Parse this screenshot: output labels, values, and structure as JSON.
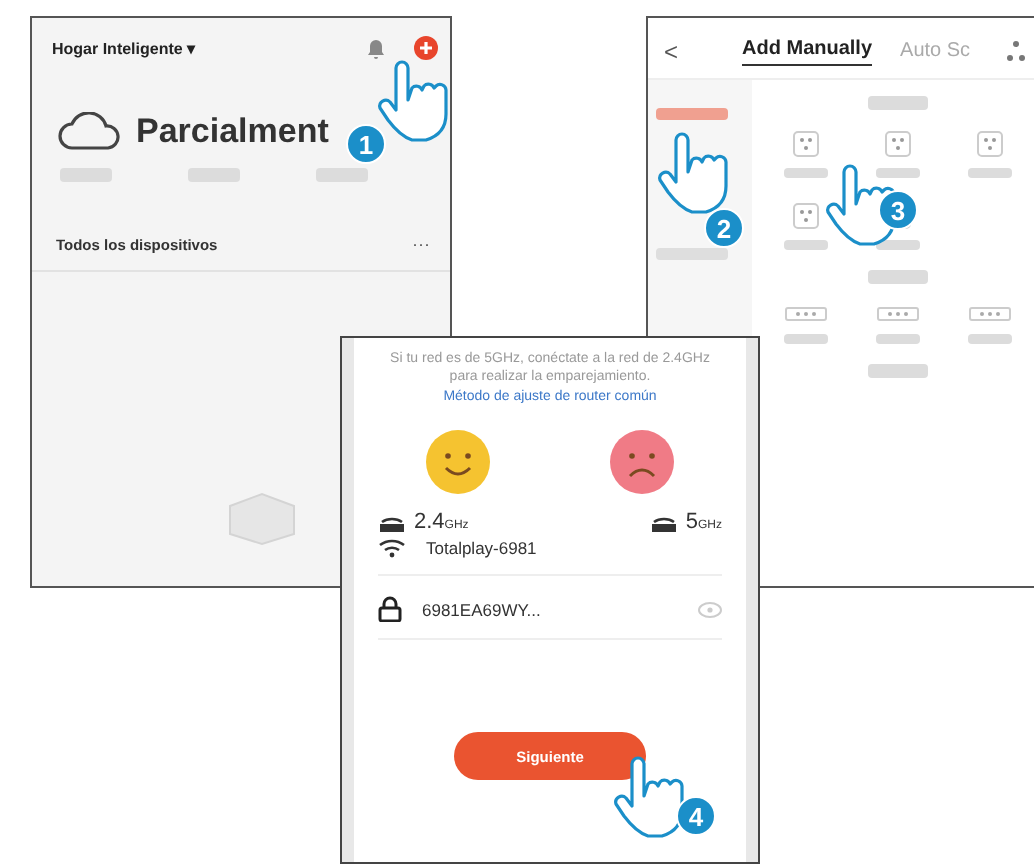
{
  "home_screen": {
    "home_name": "Hogar Inteligente",
    "dropdown_glyph": "▾",
    "weather": "Parcialment",
    "devices_heading": "Todos los dispositivos",
    "more_glyph": "···"
  },
  "add_screen": {
    "back_glyph": "<",
    "tabs": [
      {
        "label": "Add Manually",
        "selected": true
      },
      {
        "label": "Auto Sc",
        "selected": false
      }
    ],
    "category_selected": true
  },
  "wifi_screen": {
    "note": "Si tu red es de 5GHz, conéctate a la red de 2.4GHz para realizar la emparejamiento.",
    "note_link": "Método de ajuste de router común",
    "bands": [
      {
        "value": "2.4",
        "unit": "GHz",
        "supported": true
      },
      {
        "value": "5",
        "unit": "GHz",
        "supported": false
      }
    ],
    "network": "Totalplay-6981",
    "password": "6981EA69WY...",
    "next_button": "Siguiente"
  },
  "steps": [
    {
      "number": "1"
    },
    {
      "number": "2"
    },
    {
      "number": "3"
    },
    {
      "number": "4"
    }
  ]
}
